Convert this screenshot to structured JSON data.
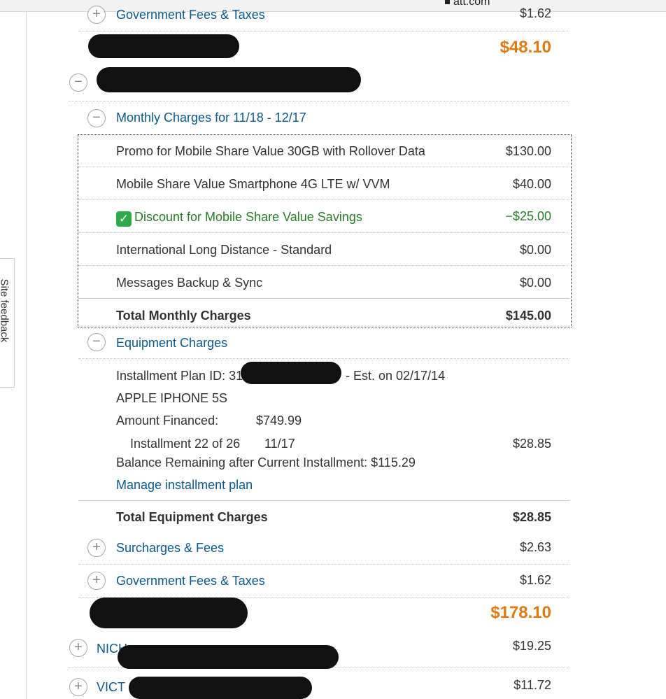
{
  "browser": {
    "url": "att.com"
  },
  "feedback": {
    "label": "Site feedback"
  },
  "sections": {
    "gov_fees_top": {
      "label": "Government Fees & Taxes",
      "amount": "$1.62"
    },
    "line1_total": {
      "amount": "$48.10"
    },
    "monthly": {
      "header": "Monthly Charges for 11/18 - 12/17",
      "items": [
        {
          "label": "Promo for Mobile Share Value 30GB with Rollover Data",
          "amount": "$130.00"
        },
        {
          "label": "Mobile Share Value Smartphone 4G LTE w/ VVM",
          "amount": "$40.00"
        },
        {
          "label": "Discount for Mobile Share Value Savings",
          "amount": "−$25.00"
        },
        {
          "label": "International Long Distance - Standard",
          "amount": "$0.00"
        },
        {
          "label": "Messages Backup & Sync",
          "amount": "$0.00"
        }
      ],
      "total_label": "Total Monthly Charges",
      "total_amount": "$145.00"
    },
    "equipment": {
      "header": "Equipment Charges",
      "plan_id_prefix": "Installment Plan ID: 31",
      "plan_id_suffix": "- Est. on 02/17/14",
      "device": "APPLE IPHONE 5S",
      "financed_label": "Amount Financed:",
      "financed_value": "$749.99",
      "installment_label": "Installment 22 of 26",
      "installment_date": "11/17",
      "installment_amount": "$28.85",
      "balance": "Balance Remaining after Current Installment: $115.29",
      "manage_link": "Manage installment plan",
      "total_label": "Total Equipment Charges",
      "total_amount": "$28.85"
    },
    "surcharges": {
      "label": "Surcharges & Fees",
      "amount": "$2.63"
    },
    "gov_fees": {
      "label": "Government Fees & Taxes",
      "amount": "$1.62"
    },
    "line2_total": {
      "amount": "$178.10"
    },
    "other_lines": [
      {
        "label": "NICH",
        "amount": "$19.25"
      },
      {
        "label": "VICT",
        "amount": "$11.72"
      }
    ]
  },
  "colors": {
    "link": "#0b5a8a",
    "accent": "#e07a12",
    "discount": "#2a7d2a"
  }
}
